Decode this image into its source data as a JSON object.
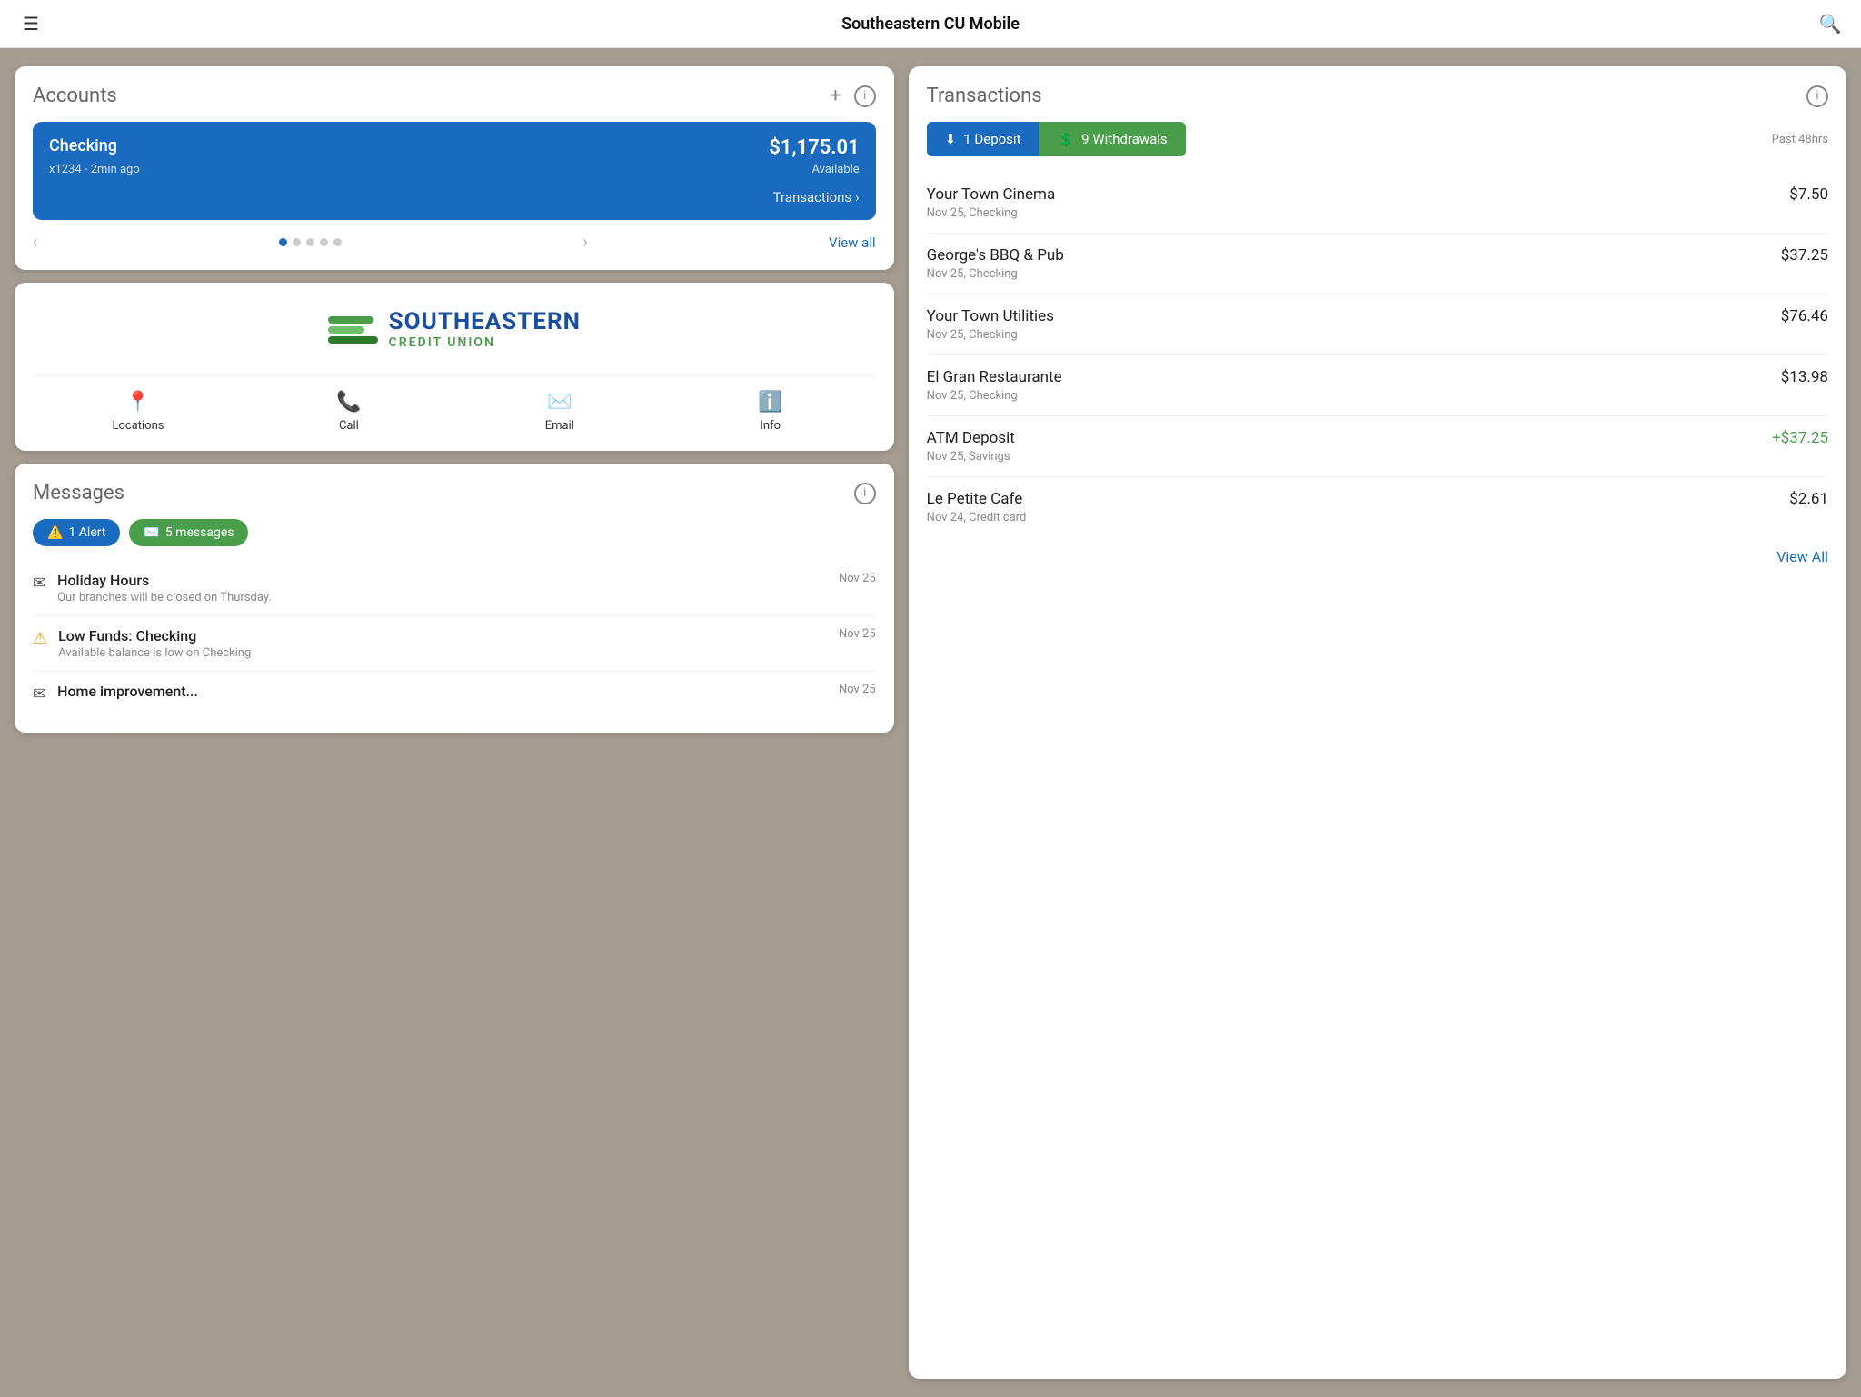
{
  "header": {
    "title": "Southeastern CU Mobile"
  },
  "accounts": {
    "title": "Accounts",
    "checking": {
      "name": "Checking",
      "account_id": "x1234 - 2min ago",
      "amount": "$1,175.01",
      "available_label": "Available",
      "transactions_link": "Transactions"
    },
    "view_all": "View all"
  },
  "credit_union": {
    "name_line1": "SOUTHEASTERN",
    "name_line2": "CREDIT UNION",
    "actions": [
      {
        "id": "locations",
        "label": "Locations",
        "icon": "📍"
      },
      {
        "id": "call",
        "label": "Call",
        "icon": "📞"
      },
      {
        "id": "email",
        "label": "Email",
        "icon": "✉️"
      },
      {
        "id": "info",
        "label": "Info",
        "icon": "ℹ️"
      }
    ]
  },
  "messages": {
    "title": "Messages",
    "badge_alert": "1 Alert",
    "badge_messages": "5 messages",
    "items": [
      {
        "type": "message",
        "title": "Holiday Hours",
        "subtitle": "Our branches will be closed on Thursday.",
        "date": "Nov 25"
      },
      {
        "type": "alert",
        "title": "Low Funds: Checking",
        "subtitle": "Available balance is low on Checking",
        "date": "Nov 25"
      },
      {
        "type": "message",
        "title": "Home improvement...",
        "subtitle": "",
        "date": "Nov 25"
      }
    ]
  },
  "transactions": {
    "title": "Transactions",
    "filter_deposit": "1 Deposit",
    "filter_withdrawal": "9 Withdrawals",
    "filter_time": "Past 48hrs",
    "items": [
      {
        "name": "Your Town Cinema",
        "meta": "Nov 25, Checking",
        "amount": "$7.50",
        "positive": false
      },
      {
        "name": "George's BBQ & Pub",
        "meta": "Nov 25, Checking",
        "amount": "$37.25",
        "positive": false
      },
      {
        "name": "Your Town Utilities",
        "meta": "Nov 25, Checking",
        "amount": "$76.46",
        "positive": false
      },
      {
        "name": "El Gran Restaurante",
        "meta": "Nov 25, Checking",
        "amount": "$13.98",
        "positive": false
      },
      {
        "name": "ATM Deposit",
        "meta": "Nov 25, Savings",
        "amount": "+$37.25",
        "positive": true
      },
      {
        "name": "Le Petite Cafe",
        "meta": "Nov 24, Credit card",
        "amount": "$2.61",
        "positive": false
      }
    ],
    "view_all": "View All"
  }
}
